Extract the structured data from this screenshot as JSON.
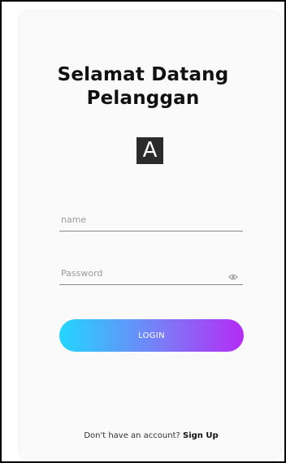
{
  "header": {
    "title_line1": "Selamat Datang",
    "title_line2": "Pelanggan",
    "logo_letter": "A"
  },
  "form": {
    "name_placeholder": "name",
    "name_value": "",
    "password_placeholder": "Password",
    "password_value": "",
    "password_toggle_icon": "eye-icon",
    "login_label": "LOGIN"
  },
  "footer": {
    "prompt": "Don't have an account?",
    "signup_label": "Sign Up"
  },
  "colors": {
    "gradient_start": "#22d6ff",
    "gradient_end": "#b42cf5",
    "logo_bg": "#2b2b2b"
  }
}
